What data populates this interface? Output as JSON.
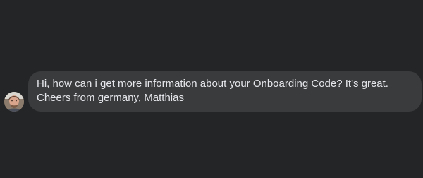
{
  "message": {
    "text": "Hi, how can i get more information about your Onboarding Code? It's great. Cheers from germany, Matthias"
  },
  "avatar": {
    "icon": "user-avatar-icon"
  },
  "colors": {
    "background": "#242526",
    "bubble": "#3a3b3c",
    "text": "#e4e6eb"
  }
}
